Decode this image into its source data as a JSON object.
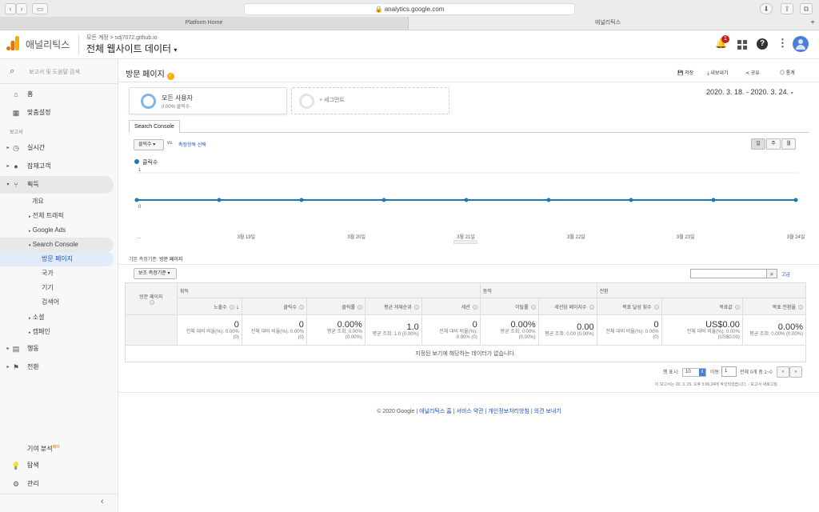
{
  "browser": {
    "url": "analytics.google.com",
    "tabs": [
      "Platform Home",
      "애널리틱스"
    ]
  },
  "header": {
    "app_name": "애널리틱스",
    "breadcrumb": "모든 계정 > sdj7072.github.io",
    "view_name": "전체 웹사이트 데이터",
    "notif_count": "1"
  },
  "sidebar": {
    "search_placeholder": "보고서 및 도움말 검색",
    "home": "홈",
    "custom": "맞춤설정",
    "reports_label": "보고서",
    "realtime": "실시간",
    "audience": "잠재고객",
    "acquisition": "획득",
    "acq_sub": {
      "overview": "개요",
      "all_traffic": "전체 트래픽",
      "google_ads": "Google Ads",
      "search_console": "Search Console",
      "landing": "방문 페이지",
      "country": "국가",
      "device": "기기",
      "queries": "검색어",
      "social": "소셜",
      "campaign": "캠페인"
    },
    "behavior": "행동",
    "conversions": "전환",
    "attribution": "기여 분석",
    "beta": "베타",
    "discover": "탐색",
    "admin": "관리"
  },
  "page": {
    "title": "방문 페이지",
    "actions": {
      "save": "저장",
      "export": "내보내기",
      "share": "공유",
      "insights": "통계"
    }
  },
  "segments": {
    "all_users": "모든 사용자",
    "all_users_sub": "0.00% 클릭수",
    "add_segment": "+ 세그먼트"
  },
  "date_range": "2020. 3. 18. - 2020. 3. 24.",
  "report_tab": "Search Console",
  "chart_controls": {
    "metric": "클릭수",
    "vs": "vs.",
    "select_metric": "측정항목 선택",
    "day": "일",
    "week": "주",
    "month": "월"
  },
  "chart_data": {
    "type": "line",
    "x": [
      "...",
      "3월 19일",
      "3월 20일",
      "3월 21일",
      "3월 22일",
      "3월 23일",
      "3월 24일"
    ],
    "series": [
      {
        "name": "클릭수",
        "values": [
          0,
          0,
          0,
          0,
          0,
          0,
          0,
          0,
          0
        ]
      }
    ],
    "y_ticks": [
      "1",
      "0"
    ],
    "ylim": [
      0,
      1
    ],
    "color": "#1f77b4"
  },
  "dimension": {
    "label": "기본 측정기준:",
    "value": "방문 페이지",
    "secondary": "보조 측정기준"
  },
  "table": {
    "advanced": "고급",
    "col_page": "방문 페이지",
    "groups": [
      "획득",
      "동작",
      "전환"
    ],
    "metrics": [
      "노출수",
      "클릭수",
      "클릭률",
      "평균 게재순위",
      "세션",
      "이탈률",
      "세션당 페이지수",
      "목표 달성 횟수",
      "목표값",
      "목표 전환율"
    ],
    "totals": [
      {
        "big": "0",
        "sm": "전체 대비 비율(%): 0.00% (0)"
      },
      {
        "big": "0",
        "sm": "전체 대비 비율(%): 0.00% (0)"
      },
      {
        "big": "0.00%",
        "sm": "평균 조회: 0.00% (0.00%)"
      },
      {
        "big": "1.0",
        "sm": "평균 조회: 1.0 (0.00%)"
      },
      {
        "big": "0",
        "sm": "전체 대비 비율(%): 0.00% (0)"
      },
      {
        "big": "0.00%",
        "sm": "평균 조회: 0.00% (0.00%)"
      },
      {
        "big": "0.00",
        "sm": "평균 조회: 0.00 (0.00%)"
      },
      {
        "big": "0",
        "sm": "전체 대비 비율(%): 0.00% (0)"
      },
      {
        "big": "US$0.00",
        "sm": "전체 대비 비율(%): 0.00% (US$0.00)"
      },
      {
        "big": "0.00%",
        "sm": "평균 조회: 0.00% (0.00%)"
      }
    ],
    "empty": "지정된 보기에 해당하는 데이터가 없습니다."
  },
  "pagination": {
    "rows_label": "행 표시:",
    "rows": "10",
    "goto_label": "이동:",
    "goto": "1",
    "range": "전체 0개 중 1~0"
  },
  "report_note": "이 보고서는 20. 3. 25. 오후 5:06:24에 작성되었습니다. - 보고서 새로고침",
  "footer": {
    "copyright": "© 2020 Google",
    "links": [
      "애널리틱스 홈",
      "서비스 약관",
      "개인정보처리방침",
      "의견 보내기"
    ]
  }
}
